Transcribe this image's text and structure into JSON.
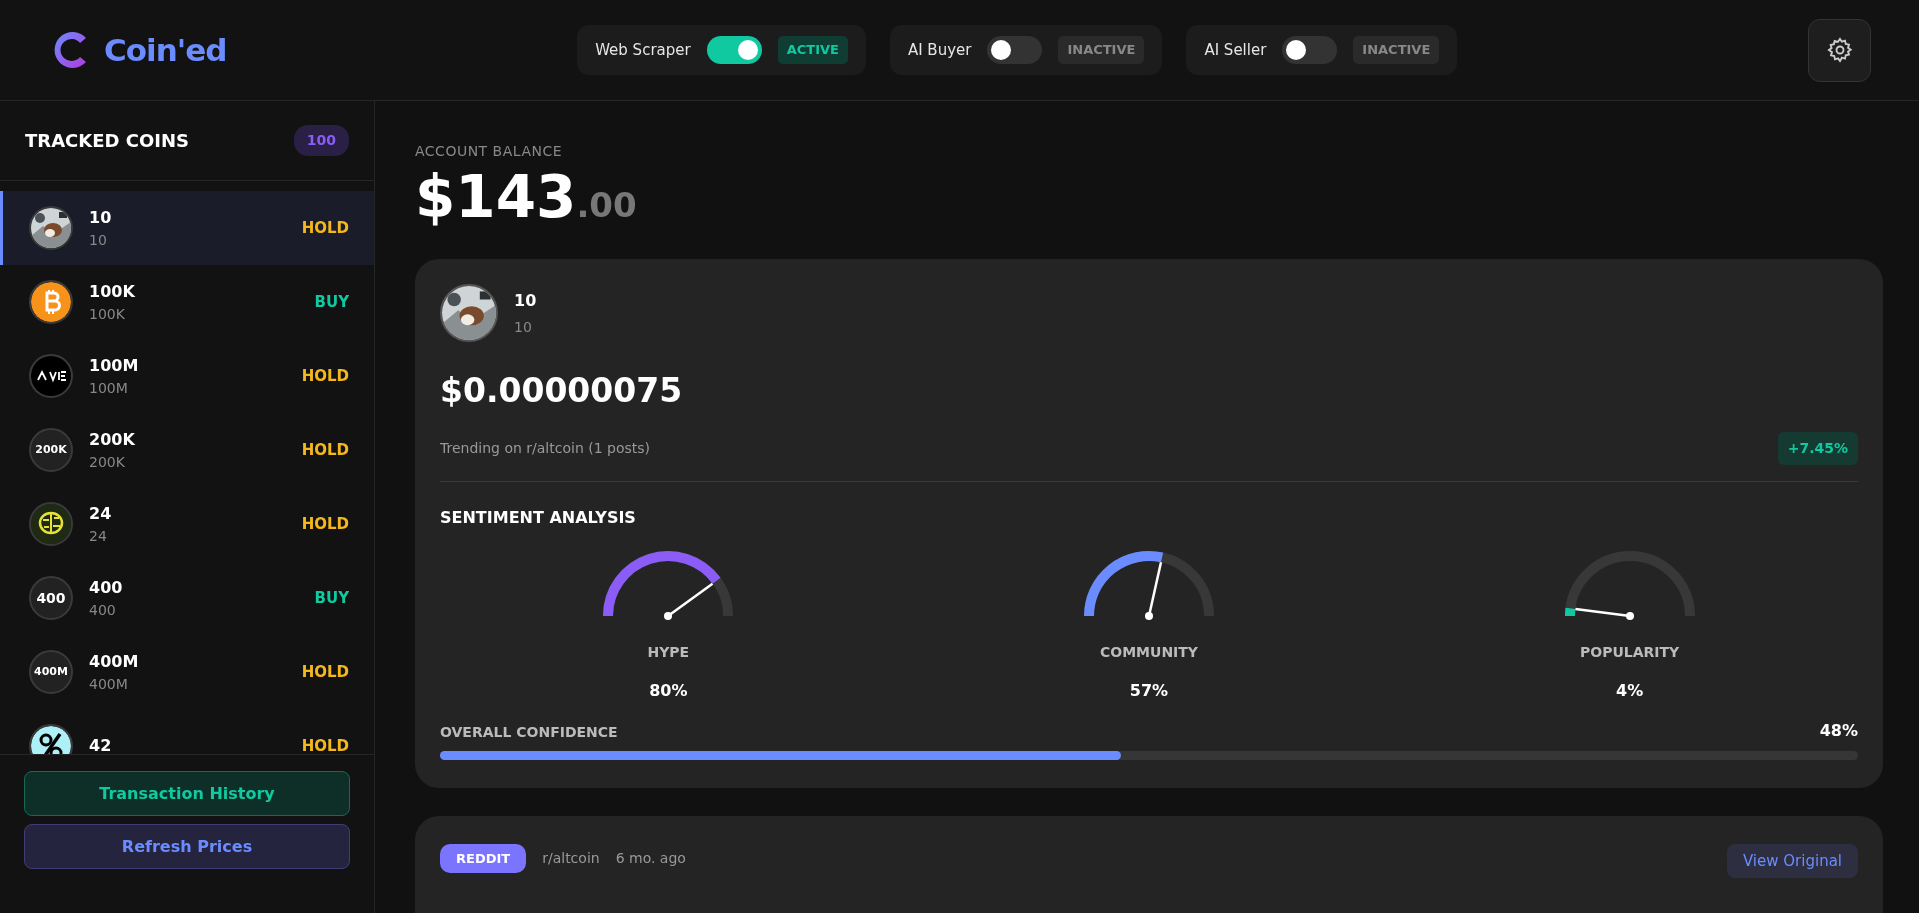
{
  "brand": {
    "name": "Coin'ed"
  },
  "toggles": [
    {
      "label": "Web Scraper",
      "on": true,
      "status": "ACTIVE"
    },
    {
      "label": "AI Buyer",
      "on": false,
      "status": "INACTIVE"
    },
    {
      "label": "AI Seller",
      "on": false,
      "status": "INACTIVE"
    }
  ],
  "sidebar": {
    "title": "TRACKED COINS",
    "count": "100",
    "items": [
      {
        "name": "10",
        "symbol": "10",
        "signal": "HOLD",
        "selected": true,
        "kind": "picture"
      },
      {
        "name": "100K",
        "symbol": "100K",
        "signal": "BUY",
        "selected": false,
        "kind": "bitcoin"
      },
      {
        "name": "100M",
        "symbol": "100M",
        "signal": "HOLD",
        "selected": false,
        "kind": "logo"
      },
      {
        "name": "200K",
        "symbol": "200K",
        "signal": "HOLD",
        "selected": false,
        "kind": "text",
        "avatar_text": "200K"
      },
      {
        "name": "24",
        "symbol": "24",
        "signal": "HOLD",
        "selected": false,
        "kind": "brain"
      },
      {
        "name": "400",
        "symbol": "400",
        "signal": "BUY",
        "selected": false,
        "kind": "text",
        "avatar_text": "400"
      },
      {
        "name": "400M",
        "symbol": "400M",
        "signal": "HOLD",
        "selected": false,
        "kind": "text",
        "avatar_text": "400M"
      },
      {
        "name": "42",
        "signal": "HOLD",
        "selected": false,
        "kind": "percent"
      }
    ],
    "buttons": [
      {
        "label": "Transaction History",
        "kind": "green"
      },
      {
        "label": "Refresh Prices",
        "kind": "blue"
      }
    ]
  },
  "balance": {
    "label": "ACCOUNT BALANCE",
    "whole": "$143",
    "cents": ".00"
  },
  "coin_card": {
    "name": "10",
    "symbol": "10",
    "price": "$0.00000075",
    "trending": "Trending on r/altcoin (1 posts)",
    "change": "+7.45%",
    "sentiment_title": "SENTIMENT ANALYSIS",
    "gauges": [
      {
        "label": "HYPE",
        "value": "80%",
        "level": 0.8,
        "color": "#8b5cf6"
      },
      {
        "label": "COMMUNITY",
        "value": "57%",
        "level": 0.57,
        "color": "#6b8cff"
      },
      {
        "label": "POPULARITY",
        "value": "4%",
        "level": 0.04,
        "color": "#10c9a0"
      }
    ],
    "confidence": {
      "label": "OVERALL CONFIDENCE",
      "value": "48%",
      "level": 0.48
    }
  },
  "post_card": {
    "source": "REDDIT",
    "subreddit": "r/altcoin",
    "time": "6 mo. ago",
    "link": "View Original"
  }
}
